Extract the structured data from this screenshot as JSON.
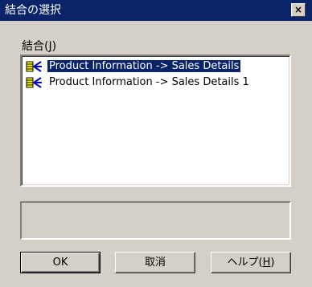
{
  "window": {
    "title": "結合の選択",
    "close_label": "×"
  },
  "joins": {
    "label": "結合(J)",
    "label_main": "結合(",
    "label_mnemonic": "J",
    "label_end": ")",
    "items": [
      {
        "label": "Product Information -> Sales Details",
        "selected": true
      },
      {
        "label": "Product Information -> Sales Details 1",
        "selected": false
      }
    ]
  },
  "buttons": {
    "ok": "OK",
    "cancel": "取消",
    "help": "ヘルプ(H)",
    "help_main": "ヘルプ(",
    "help_mnemonic": "H",
    "help_end": ")"
  },
  "colors": {
    "titlebar": "#0a246a",
    "selection": "#0a246a",
    "dialog": "#d4d0c8",
    "icon_yellow": "#ffff00",
    "icon_blue": "#0000c0"
  }
}
